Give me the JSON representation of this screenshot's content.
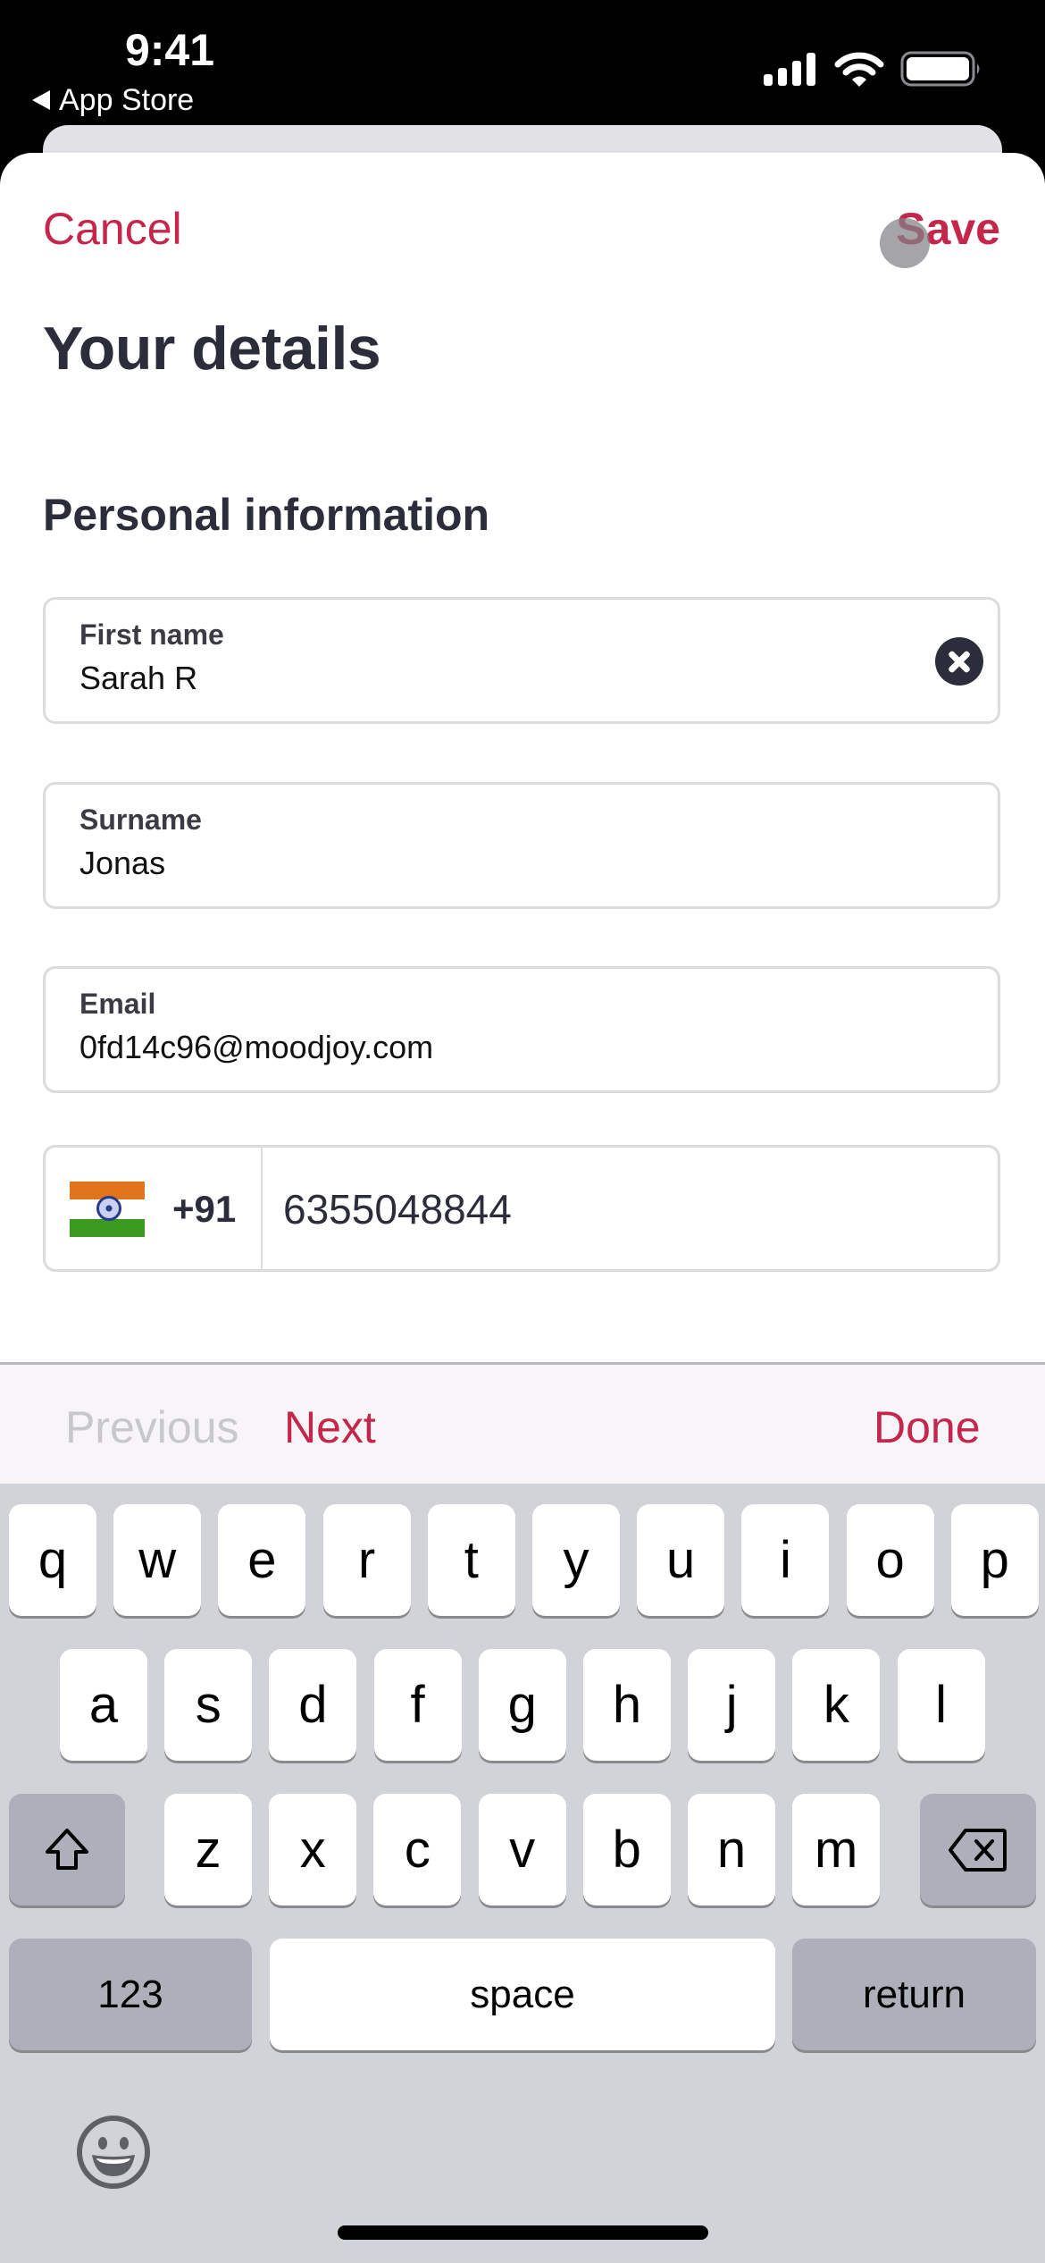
{
  "status_bar": {
    "time": "9:41",
    "back_app": "App Store",
    "icons": [
      "cellular-signal-icon",
      "wifi-icon",
      "battery-icon"
    ]
  },
  "nav": {
    "cancel_label": "Cancel",
    "save_label": "Save"
  },
  "page": {
    "title": "Your details",
    "section_title": "Personal information"
  },
  "fields": {
    "first_name": {
      "label": "First name",
      "value": "Sarah R"
    },
    "surname": {
      "label": "Surname",
      "value": "Jonas"
    },
    "email": {
      "label": "Email",
      "value": "0fd14c96@moodjoy.com"
    },
    "phone": {
      "country_flag": "india-flag-icon",
      "dial_code": "+91",
      "value": "6355048844"
    }
  },
  "accessory_bar": {
    "previous_label": "Previous",
    "next_label": "Next",
    "done_label": "Done"
  },
  "keyboard": {
    "row1": [
      "q",
      "w",
      "e",
      "r",
      "t",
      "y",
      "u",
      "i",
      "o",
      "p"
    ],
    "row2": [
      "a",
      "s",
      "d",
      "f",
      "g",
      "h",
      "j",
      "k",
      "l"
    ],
    "row3": [
      "z",
      "x",
      "c",
      "v",
      "b",
      "n",
      "m"
    ],
    "numbers_label": "123",
    "space_label": "space",
    "return_label": "return"
  },
  "colors": {
    "accent": "#c4264c",
    "text_dark": "#2b2d3a",
    "keyboard_bg": "#d2d3d8"
  }
}
